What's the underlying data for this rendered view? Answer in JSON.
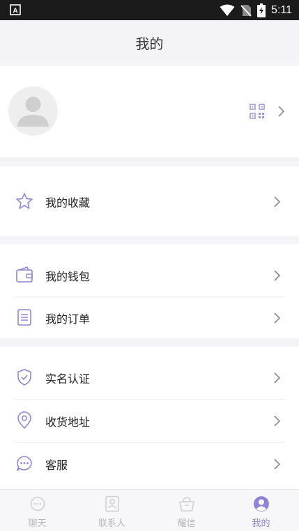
{
  "status_bar": {
    "time": "5:11"
  },
  "header": {
    "title": "我的"
  },
  "profile": {
    "avatar": "avatar-placeholder-icon",
    "qr": "qr-code-icon"
  },
  "sections": [
    {
      "items": [
        {
          "label": "我的收藏",
          "icon": "star-icon"
        }
      ]
    },
    {
      "items": [
        {
          "label": "我的钱包",
          "icon": "wallet-icon"
        },
        {
          "label": "我的订单",
          "icon": "order-list-icon"
        }
      ]
    },
    {
      "items": [
        {
          "label": "实名认证",
          "icon": "shield-check-icon"
        },
        {
          "label": "收货地址",
          "icon": "location-pin-icon"
        },
        {
          "label": "客服",
          "icon": "chat-bubble-icon"
        }
      ]
    }
  ],
  "tabs": [
    {
      "label": "聊天",
      "icon": "chat-icon",
      "active": false
    },
    {
      "label": "联系人",
      "icon": "contacts-icon",
      "active": false
    },
    {
      "label": "耀信",
      "icon": "basket-icon",
      "active": false
    },
    {
      "label": "我的",
      "icon": "profile-icon",
      "active": true
    }
  ],
  "colors": {
    "accent": "#8f85d8",
    "background": "#f3f3f8",
    "card": "#ffffff",
    "text": "#222222",
    "tab_inactive": "#b5b5bb"
  }
}
